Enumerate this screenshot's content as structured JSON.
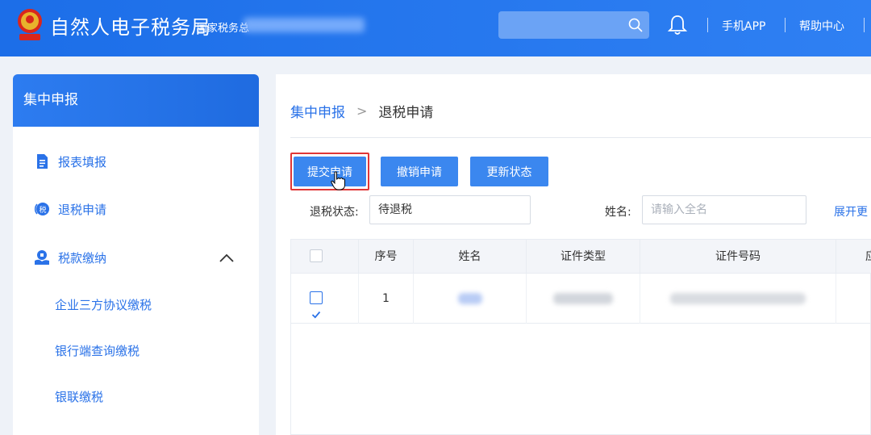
{
  "header": {
    "site_title": "自然人电子税务局",
    "site_sub": "国家税务总",
    "links": [
      "手机APP",
      "帮助中心"
    ],
    "icons": [
      "national-emblem-icon",
      "search-icon",
      "bell-icon"
    ],
    "colors": {
      "header_bg": "#1f70ea",
      "accent": "#2a72e8",
      "highlight": "#e13636"
    }
  },
  "sidebar": {
    "title": "集中申报",
    "items": [
      {
        "label": "报表填报",
        "icon": "document-icon"
      },
      {
        "label": "退税申请",
        "icon": "refund-icon"
      },
      {
        "label": "税款缴纳",
        "icon": "payment-icon",
        "expanded": true
      }
    ],
    "subitems": [
      "企业三方协议缴税",
      "银行端查询缴税",
      "银联缴税"
    ]
  },
  "breadcrumb": {
    "parent": "集中申报",
    "separator": ">",
    "current": "退税申请"
  },
  "toolbar": {
    "submit": "提交申请",
    "revoke": "撤销申请",
    "update": "更新状态"
  },
  "filters": {
    "status_label": "退税状态:",
    "status_value": "待退税",
    "name_label": "姓名:",
    "name_placeholder": "请输入全名",
    "expand": "展开更"
  },
  "table": {
    "columns": [
      "序号",
      "姓名",
      "证件类型",
      "证件号码",
      "应"
    ],
    "rows": [
      {
        "checked": true,
        "index": "1"
      }
    ]
  }
}
